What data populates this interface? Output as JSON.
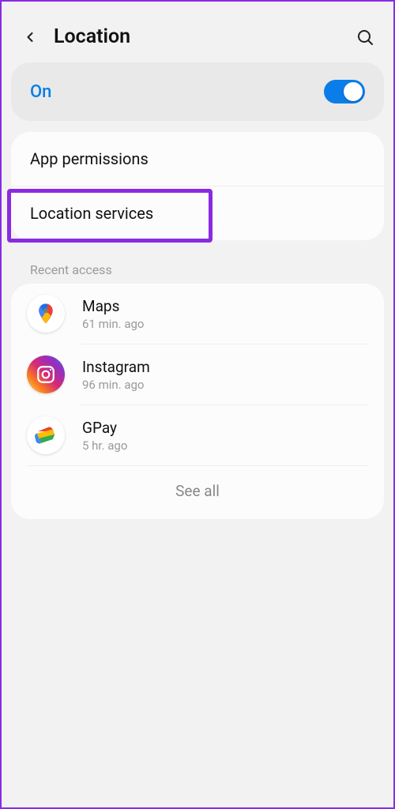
{
  "header": {
    "title": "Location"
  },
  "toggle": {
    "label": "On",
    "state": true
  },
  "menu": {
    "app_permissions": "App permissions",
    "location_services": "Location services"
  },
  "recent": {
    "section_label": "Recent access",
    "apps": [
      {
        "name": "Maps",
        "time": "61 min. ago",
        "icon": "maps-icon"
      },
      {
        "name": "Instagram",
        "time": "96 min. ago",
        "icon": "instagram-icon"
      },
      {
        "name": "GPay",
        "time": "5 hr. ago",
        "icon": "gpay-icon"
      }
    ],
    "see_all": "See all"
  }
}
